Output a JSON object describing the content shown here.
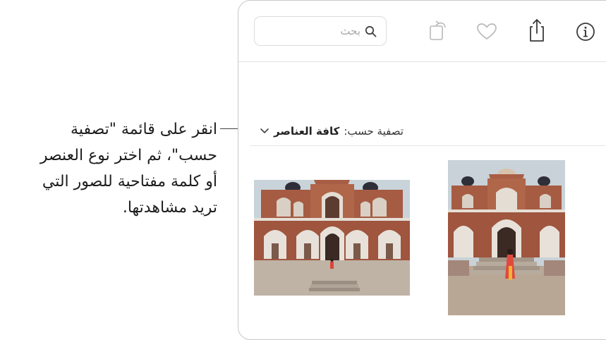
{
  "callout": {
    "text": "انقر على قائمة \"تصفية حسب\"، ثم اختر نوع العنصر أو كلمة مفتاحية للصور التي تريد مشاهدتها."
  },
  "toolbar": {
    "search_placeholder": "بحث",
    "icons": [
      "info-icon",
      "share-icon",
      "favorite-heart-icon",
      "rotate-icon",
      "search-icon"
    ]
  },
  "filter": {
    "label": "تصفية حسب:",
    "value": "كافة العناصر"
  },
  "photos": [
    {
      "orientation": "landscape"
    },
    {
      "orientation": "portrait"
    }
  ]
}
